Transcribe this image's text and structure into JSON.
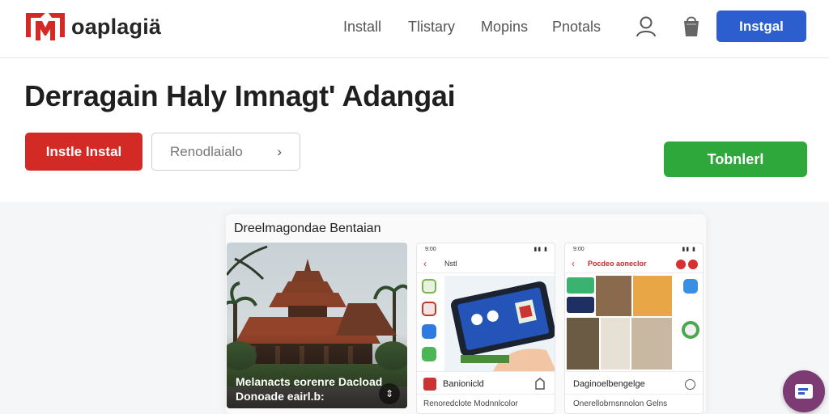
{
  "header": {
    "brand": "oaplagiä",
    "nav": [
      "Install",
      "Tlistary",
      "Mopins",
      "Pnotals"
    ],
    "cta_label": "Instgal"
  },
  "hero": {
    "title": "Derragain Haly Imnagt' Adangai",
    "primary_label": "Instle Instal",
    "secondary_label": "Renodlaialo",
    "secondary_chevron": "›",
    "green_label": "Tobnlerl"
  },
  "gallery": {
    "title": "Dreelmagondae Bentaian",
    "photo_caption_1": "Melanacts eorenre Dacload",
    "photo_caption_2": "Donoade eairl.b:",
    "phone1": {
      "status_time": "9:00",
      "title": "Nstl",
      "footer_title": "Banionicld",
      "footer_sub": "Renoredclote Modnnlcolor"
    },
    "phone2": {
      "status_time": "9:00",
      "title": "Pocdeo aoneclor",
      "footer_title": "Daginoelbengelge",
      "footer_sub": "Onerellobrnsnnolon Gelns"
    }
  },
  "colors": {
    "brand_red": "#d42a26",
    "nav_blue": "#2c5fcd",
    "green": "#2fa83b",
    "fab_purple": "#7c3b73"
  },
  "icons": [
    "logo-icon",
    "user-icon",
    "shopping-bag-icon",
    "chevron-right-icon",
    "back-arrow-icon",
    "share-icon",
    "chat-icon"
  ]
}
